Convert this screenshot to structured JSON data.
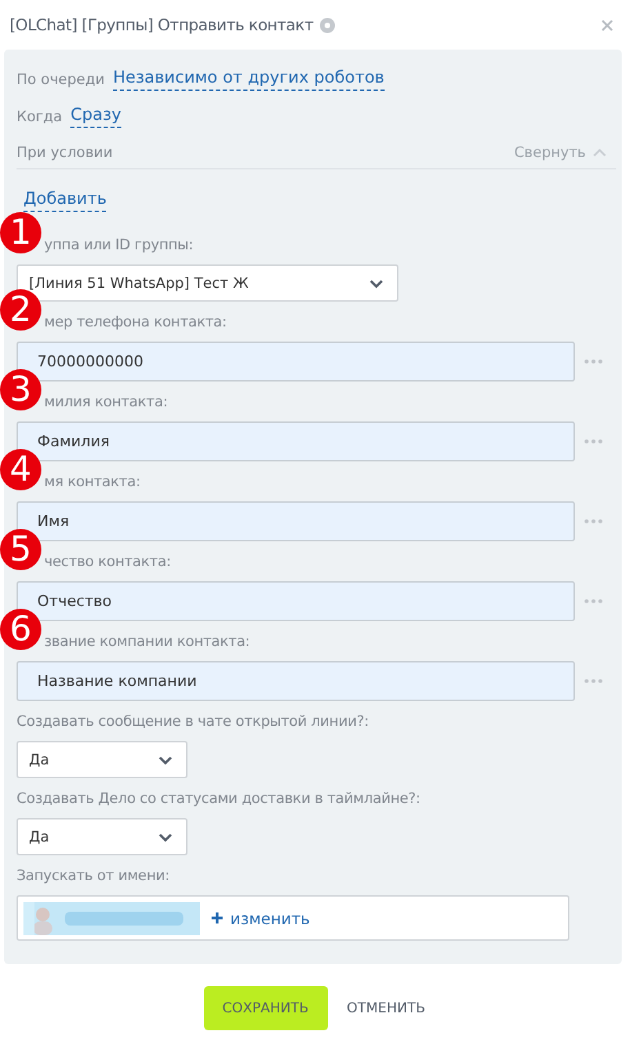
{
  "dialog": {
    "title": "[OLChat] [Группы] Отправить контакт"
  },
  "settings": [
    {
      "label": "По очереди",
      "value": "Независимо от других роботов"
    },
    {
      "label": "Когда",
      "value": "Сразу"
    }
  ],
  "condition": {
    "label": "При условии",
    "toggle": "Свернуть",
    "expanded": true,
    "add_link": "Добавить"
  },
  "fields": [
    {
      "kind": "select",
      "marker": "1",
      "label": "уппа или ID группы:",
      "value": "[Линия 51 WhatsApp] Тест Ж"
    },
    {
      "kind": "input",
      "marker": "2",
      "label": "мер телефона контакта:",
      "value": "70000000000"
    },
    {
      "kind": "input",
      "marker": "3",
      "label": "милия контакта:",
      "value": "Фамилия"
    },
    {
      "kind": "input",
      "marker": "4",
      "label": "мя контакта:",
      "value": "Имя"
    },
    {
      "kind": "input",
      "marker": "5",
      "label": "чество контакта:",
      "value": "Отчество"
    },
    {
      "kind": "input",
      "marker": "6",
      "label": "звание компании контакта:",
      "value": "Название компании"
    },
    {
      "kind": "choice",
      "label": "Создавать сообщение в чате открытой линии?:",
      "value": "Да"
    },
    {
      "kind": "choice",
      "label": "Создавать Дело со статусами доставки в таймлайне?:",
      "value": "Да"
    },
    {
      "kind": "user",
      "label": "Запускать от имени:",
      "action": "изменить"
    }
  ],
  "buttons": [
    {
      "kind": "primary",
      "label": "СОХРАНИТЬ"
    },
    {
      "kind": "link",
      "label": "ОТМЕНИТЬ"
    }
  ]
}
